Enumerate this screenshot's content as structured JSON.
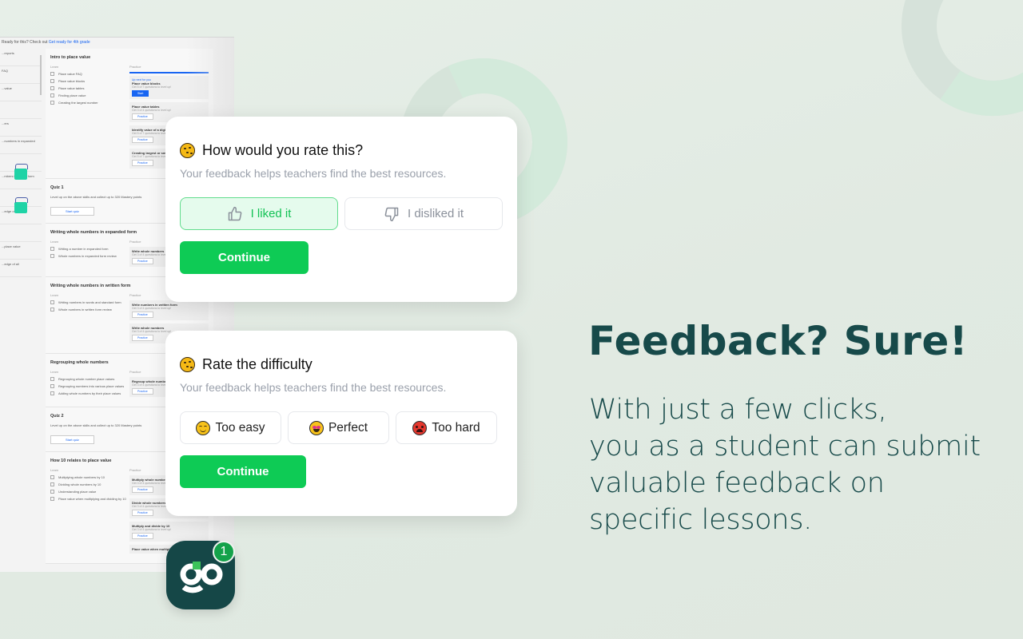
{
  "background_page": {
    "notice_text": "Ready for this? Check out",
    "notice_link": "Get ready for 4th grade",
    "left_items": [
      "...reports",
      "FAQ",
      "...value",
      "",
      "...ers",
      "...numbers in expanded",
      "",
      "...mbers in written form",
      "",
      "...edge of all",
      "",
      "...place value",
      "...edge of all"
    ],
    "sections": [
      {
        "title": "Intro to place value",
        "learn_header": "Learn",
        "practice_header": "Practice",
        "learn": [
          "Place value FAQ",
          "Place value blocks",
          "Place value tables",
          "Finding place value",
          "Creating the largest number"
        ],
        "practice": [
          {
            "tag": "Up next for you",
            "title": "Place value blocks",
            "sub": "Get 5 of 7 questions to level up!",
            "button": "Start"
          },
          {
            "title": "Place value tables",
            "sub": "Get 3 of 4 questions to level up!",
            "button": "Practice"
          },
          {
            "title": "Identify value of a digit",
            "sub": "Get 5 of 7 questions to level up!",
            "button": "Practice"
          },
          {
            "title": "Creating largest or smallest",
            "sub": "Get 5 of 7 questions to level up!",
            "button": "Practice"
          }
        ]
      },
      {
        "title": "Quiz 1",
        "desc": "Level up on the above skills and collect up to 320 Mastery points",
        "button": "Start quiz"
      },
      {
        "title": "Writing whole numbers in expanded form",
        "learn_header": "Learn",
        "practice_header": "Practice",
        "learn": [
          "Writing a number in expanded form",
          "Whole numbers in expanded form review"
        ],
        "practice": [
          {
            "title": "Write whole numbers",
            "sub": "Get 3 of 4 questions to level up!",
            "button": "Practice"
          }
        ]
      },
      {
        "title": "Writing whole numbers in written form",
        "learn_header": "Learn",
        "practice_header": "Practice",
        "learn": [
          "Writing numbers in words and standard form",
          "Whole numbers in written form review"
        ],
        "practice": [
          {
            "title": "Write numbers in written form",
            "sub": "Get 3 of 4 questions to level up!",
            "button": "Practice"
          },
          {
            "title": "Write whole numbers",
            "sub": "Get 3 of 4 questions to level up!",
            "button": "Practice"
          }
        ]
      },
      {
        "title": "Regrouping whole numbers",
        "learn_header": "Learn",
        "practice_header": "Practice",
        "learn": [
          "Regrouping whole number place values",
          "Regrouping numbers into various place values",
          "Adding whole numbers by their place values"
        ],
        "practice": [
          {
            "title": "Regroup whole numbers",
            "sub": "Get 3 of 4 questions to level up!",
            "button": "Practice"
          }
        ]
      },
      {
        "title": "Quiz 2",
        "desc": "Level up on the above skills and collect up to 320 Mastery points",
        "button": "Start quiz"
      },
      {
        "title": "How 10 relates to place value",
        "learn_header": "Learn",
        "practice_header": "Practice",
        "learn": [
          "Multiplying whole numbers by 10",
          "Dividing whole numbers by 10",
          "Understanding place value",
          "Place value when multiplying and dividing by 10"
        ],
        "practice": [
          {
            "title": "Multiply whole numbers",
            "sub": "Get 3 of 4 questions to level up!",
            "button": "Practice"
          },
          {
            "title": "Divide whole numbers by 10",
            "sub": "Get 3 of 4 questions to level up!",
            "button": "Practice"
          },
          {
            "title": "Multiply and divide by 10",
            "sub": "Get 3 of 4 questions to level up!",
            "button": "Practice"
          },
          {
            "title": "Place value when multiplying by 10",
            "sub": "",
            "button": ""
          }
        ]
      }
    ]
  },
  "rating_card": {
    "icon": "cookie-icon",
    "title": "How would you rate this?",
    "subtitle": "Your feedback helps teachers find the best resources.",
    "options": [
      {
        "label": "I liked it",
        "icon": "thumbs-up-icon",
        "selected": true
      },
      {
        "label": "I disliked it",
        "icon": "thumbs-down-icon",
        "selected": false
      }
    ],
    "continue_label": "Continue"
  },
  "difficulty_card": {
    "icon": "cookie-icon",
    "title": "Rate the difficulty",
    "subtitle": "Your feedback helps teachers find the best resources.",
    "options": [
      {
        "label": "Too easy",
        "icon": "smiling-face-icon"
      },
      {
        "label": "Perfect",
        "icon": "heart-eyes-face-icon"
      },
      {
        "label": "Too hard",
        "icon": "hot-face-icon"
      }
    ],
    "continue_label": "Continue"
  },
  "hero": {
    "title": "Feedback? Sure!",
    "body_lines": [
      "With just a few clicks,",
      "you as a student can submit",
      "valuable feedback on",
      "specific lessons."
    ]
  },
  "app_icon": {
    "label": "go",
    "badge_count": "1"
  },
  "colors": {
    "brand_dark": "#154747",
    "accent_green": "#0ecb55",
    "selected_bg": "#e5fbed",
    "heading_text": "#174a4a",
    "badge_green": "#14a24a"
  }
}
